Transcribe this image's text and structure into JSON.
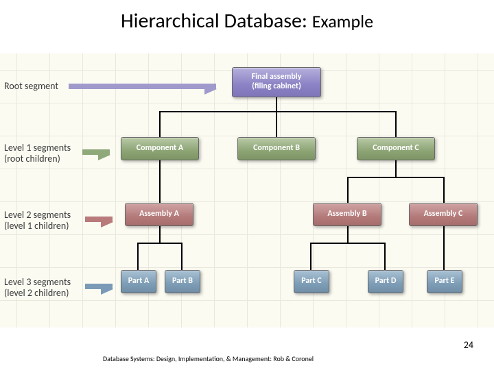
{
  "title_main": "Hierarchical Database:",
  "title_sub": "Example",
  "labels": {
    "root": "Root segment",
    "l1a": "Level 1 segments",
    "l1b": "(root children)",
    "l2a": "Level 2 segments",
    "l2b": "(level 1 children)",
    "l3a": "Level 3 segments",
    "l3b": "(level 2 children)"
  },
  "nodes": {
    "root1": "Final assembly",
    "root2": "(filing cabinet)",
    "compA": "Component A",
    "compB": "Component B",
    "compC": "Component C",
    "asmA": "Assembly A",
    "asmB": "Assembly B",
    "asmC": "Assembly C",
    "partA": "Part A",
    "partB": "Part B",
    "partC": "Part C",
    "partD": "Part D",
    "partE": "Part E"
  },
  "footer": "Database Systems: Design, Implementation, & Management: Rob & Coronel",
  "page": "24"
}
